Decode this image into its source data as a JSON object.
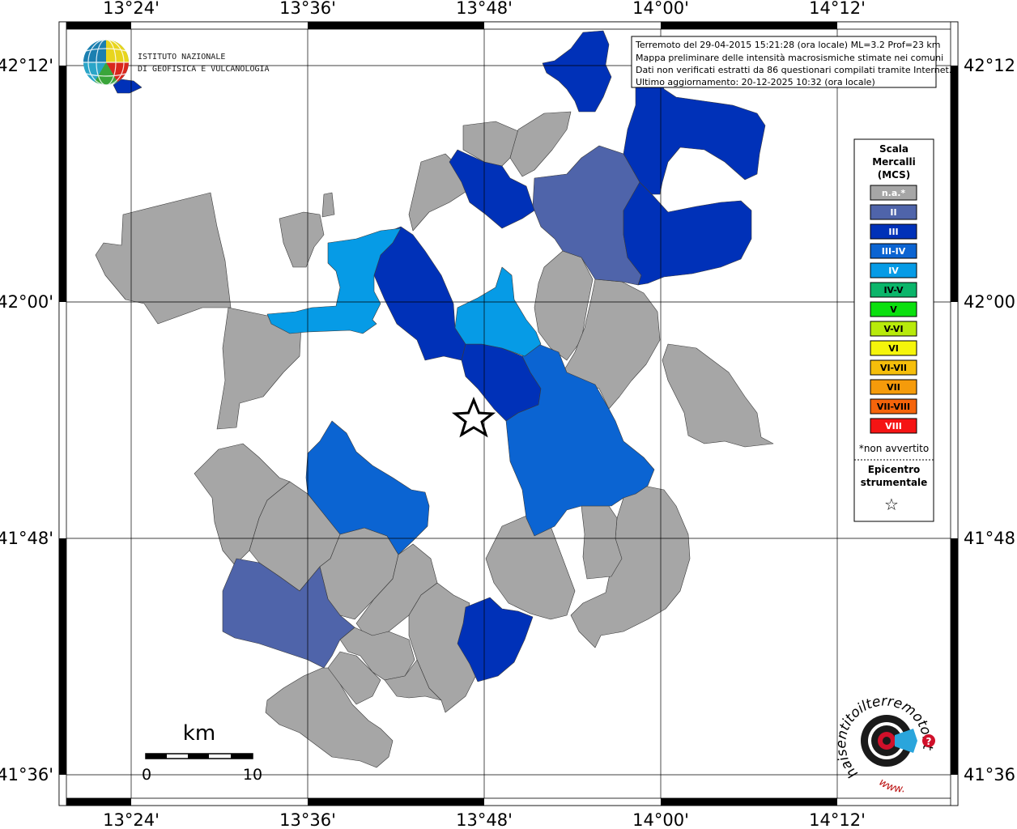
{
  "map": {
    "lon_labels": [
      "13°24'",
      "13°36'",
      "13°48'",
      "14°00'",
      "14°12'"
    ],
    "lat_labels": [
      "42°12'",
      "42°00'",
      "41°48'",
      "41°36'"
    ]
  },
  "info": {
    "line1": "Terremoto del 29-04-2015 15:21:28 (ora locale) ML=3.2 Prof=23 km",
    "line2": "Mappa preliminare delle intensità macrosismiche stimate nei comuni",
    "line3": "Dati non verificati estratti da 86 questionari compilati tramite Internet.",
    "line4": "Ultimo aggiornamento: 20-12-2025 10:32 (ora locale)"
  },
  "logo": {
    "line1": "ISTITUTO NAZIONALE",
    "line2": "DI GEOFISICA E VULCANOLOGIA"
  },
  "legend": {
    "title1": "Scala",
    "title2": "Mercalli",
    "title3": "(MCS)",
    "items": [
      {
        "label": "n.a.*",
        "color": "#a6a6a6",
        "text_color": "#ffffff"
      },
      {
        "label": "II",
        "color": "#4f64aa",
        "text_color": "#ffffff"
      },
      {
        "label": "III",
        "color": "#0031b8",
        "text_color": "#ffffff"
      },
      {
        "label": "III-IV",
        "color": "#0b64d2",
        "text_color": "#ffffff"
      },
      {
        "label": "IV",
        "color": "#069be6",
        "text_color": "#ffffff"
      },
      {
        "label": "IV-V",
        "color": "#0bb56a",
        "text_color": "#000000"
      },
      {
        "label": "V",
        "color": "#0be00f",
        "text_color": "#000000"
      },
      {
        "label": "V-VI",
        "color": "#b8ea0b",
        "text_color": "#000000"
      },
      {
        "label": "VI",
        "color": "#f5f50b",
        "text_color": "#000000"
      },
      {
        "label": "VI-VII",
        "color": "#f5be0b",
        "text_color": "#000000"
      },
      {
        "label": "VII",
        "color": "#f59b0b",
        "text_color": "#000000"
      },
      {
        "label": "VII-VIII",
        "color": "#f5640b",
        "text_color": "#000000"
      },
      {
        "label": "VIII",
        "color": "#f51414",
        "text_color": "#ffffff"
      }
    ],
    "note": "*non avvertito",
    "epicentre1": "Epicentro",
    "epicentre2": "strumentale",
    "epicentre_symbol": "☆"
  },
  "scalebar": {
    "unit": "km",
    "min_label": "0",
    "max_label": "10"
  },
  "watermark": {
    "text1": "haisentitoilterremoto.it",
    "text2": "www."
  }
}
